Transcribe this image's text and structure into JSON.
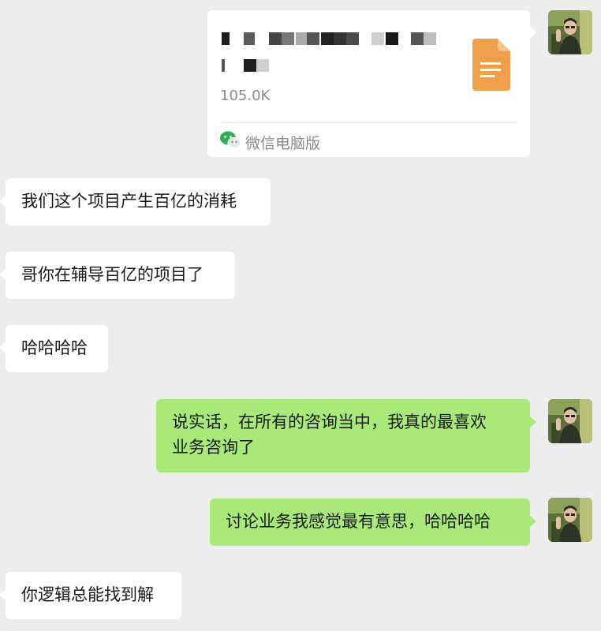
{
  "colors": {
    "background": "#ededed",
    "incoming_bubble": "#ffffff",
    "outgoing_bubble": "#a9e97a",
    "file_icon": "#f0a04b",
    "wechat_green": "#2bb24c"
  },
  "file_message": {
    "size": "105.0K",
    "source": "微信电脑版",
    "icon": "document-file-icon",
    "source_icon": "wechat-logo-icon"
  },
  "messages": [
    {
      "direction": "incoming",
      "text": "我们这个项目产生百亿的消耗"
    },
    {
      "direction": "incoming",
      "text": "哥你在辅导百亿的项目了"
    },
    {
      "direction": "incoming",
      "text": "哈哈哈哈"
    },
    {
      "direction": "outgoing",
      "line1": "说实话，在所有的咨询当中，我真的最喜欢",
      "line2": "业务咨询了"
    },
    {
      "direction": "outgoing",
      "text": "讨论业务我感觉最有意思，哈哈哈哈"
    },
    {
      "direction": "incoming",
      "text": "你逻辑总能找到解"
    }
  ],
  "avatar": {
    "icon": "user-avatar"
  }
}
